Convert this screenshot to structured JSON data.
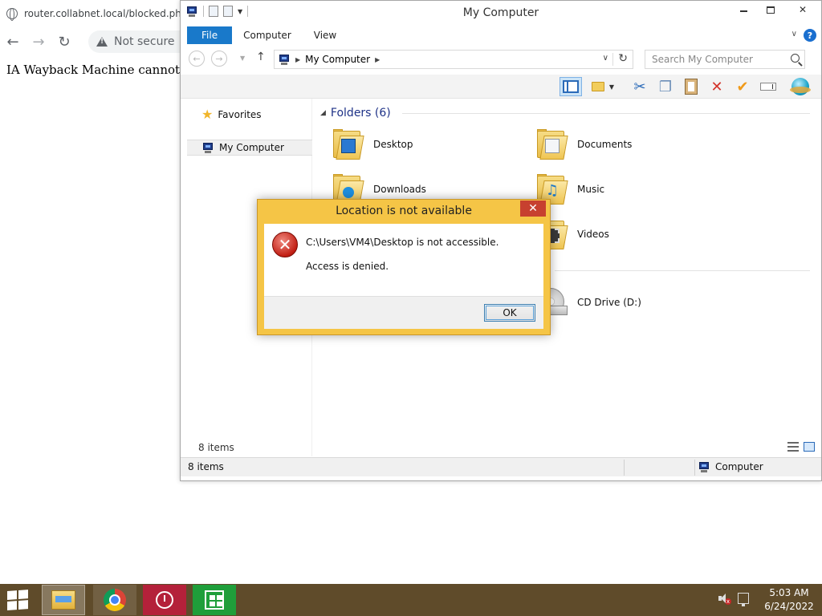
{
  "browser": {
    "tab_url": "router.collabnet.local/blocked.ph",
    "security_label": "Not secure",
    "page_text": "IA Wayback Machine cannot be u"
  },
  "explorer": {
    "title": "My Computer",
    "ribbon_tabs": [
      "File",
      "Computer",
      "View"
    ],
    "address": {
      "crumb": "My Computer"
    },
    "search_placeholder": "Search My Computer",
    "nav_pane": {
      "favorites": "Favorites",
      "my_computer": "My Computer"
    },
    "group_header": "Folders (6)",
    "items": {
      "desktop": "Desktop",
      "documents": "Documents",
      "downloads": "Downloads",
      "music": "Music",
      "videos": "Videos",
      "cd_drive": "CD Drive (D:)"
    },
    "item_count": "8 items",
    "status_left": "8 items",
    "status_right": "Computer",
    "colors": {
      "file_tab": "#1979ca",
      "group_header": "#1e3287"
    }
  },
  "dialog": {
    "title": "Location is not available",
    "message": "C:\\Users\\VM4\\Desktop is not accessible.",
    "detail": "Access is denied.",
    "ok_label": "OK",
    "colors": {
      "frame": "#f5c546",
      "close": "#c7402f"
    }
  },
  "taskbar": {
    "time": "5:03 AM",
    "date": "6/24/2022",
    "color": "#5f4b2a"
  }
}
